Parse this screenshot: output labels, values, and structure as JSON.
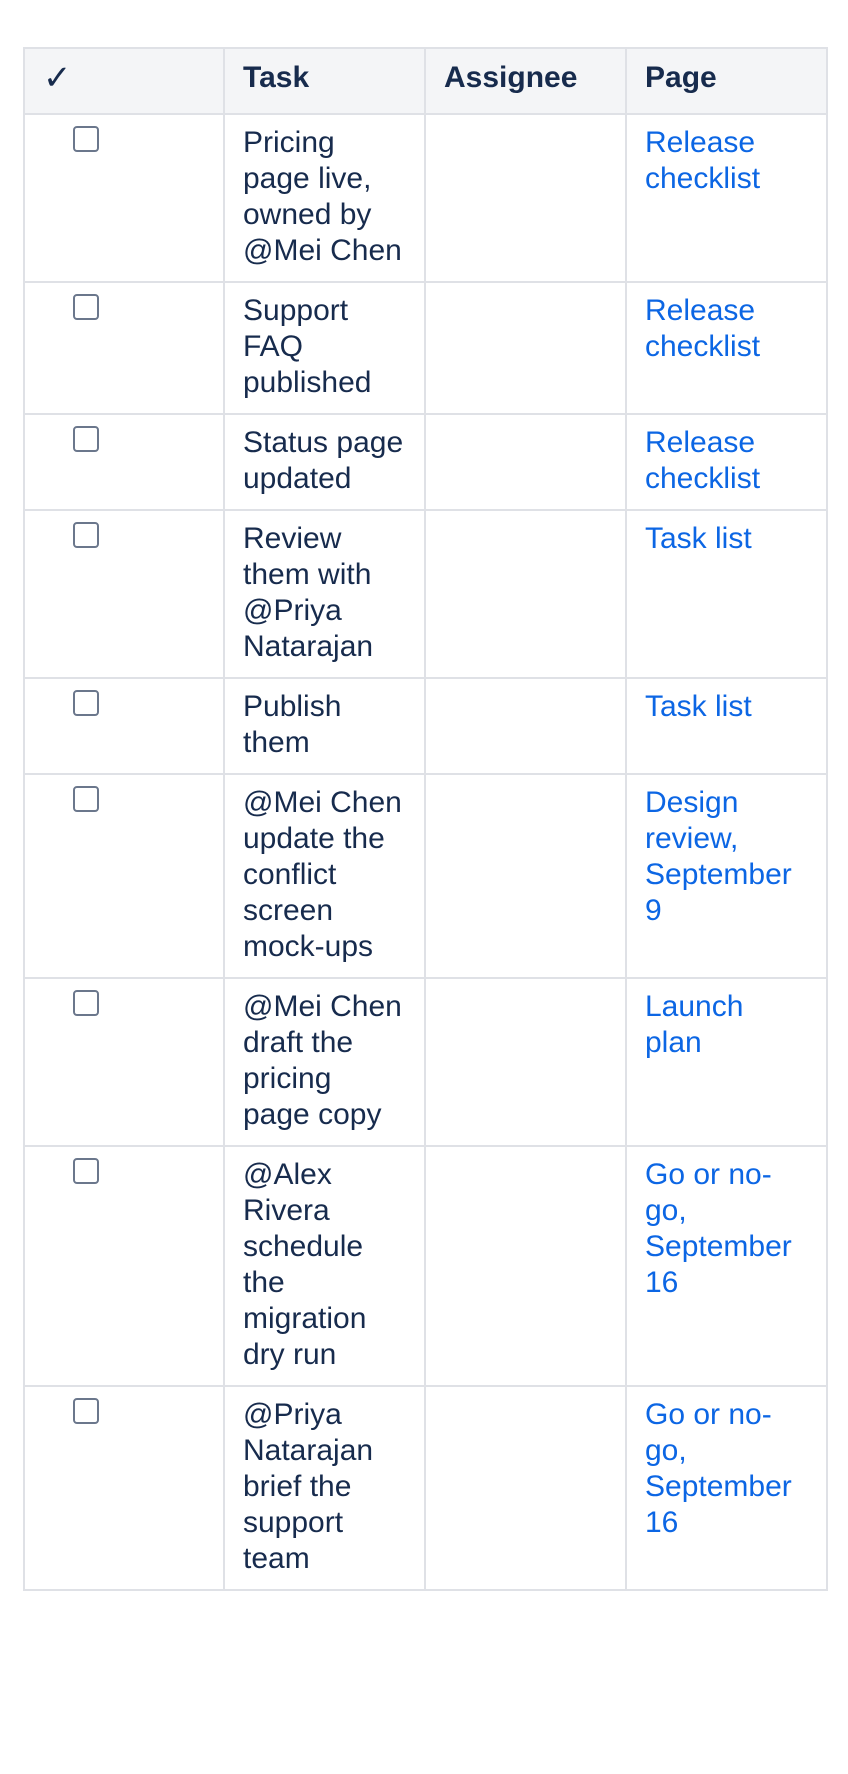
{
  "table": {
    "headers": {
      "check": "✓",
      "task": "Task",
      "assignee": "Assignee",
      "page": "Page"
    },
    "rows": [
      {
        "task": "Pricing page live, owned by @Mei Chen",
        "assignee": "",
        "page": "Release checklist",
        "checked": false
      },
      {
        "task": "Support FAQ published",
        "assignee": "",
        "page": "Release checklist",
        "checked": false
      },
      {
        "task": "Status page updated",
        "assignee": "",
        "page": "Release checklist",
        "checked": false
      },
      {
        "task": "Review them with @Priya Natarajan",
        "assignee": "",
        "page": "Task list",
        "checked": false
      },
      {
        "task": "Publish them",
        "assignee": "",
        "page": "Task list",
        "checked": false
      },
      {
        "task": "@Mei Chen update the conflict screen mock-ups",
        "assignee": "",
        "page": "Design review, September 9",
        "checked": false
      },
      {
        "task": "@Mei Chen draft the pricing page copy",
        "assignee": "",
        "page": "Launch plan",
        "checked": false
      },
      {
        "task": "@Alex Rivera schedule the migration dry run",
        "assignee": "",
        "page": "Go or no-go, September 16",
        "checked": false
      },
      {
        "task": "@Priya Natarajan brief the support team",
        "assignee": "",
        "page": "Go or no-go, September 16",
        "checked": false
      }
    ]
  },
  "colors": {
    "link": "#0c66e4",
    "text": "#172b4d",
    "header_bg": "#f4f5f7",
    "border": "#dfe1e6"
  }
}
